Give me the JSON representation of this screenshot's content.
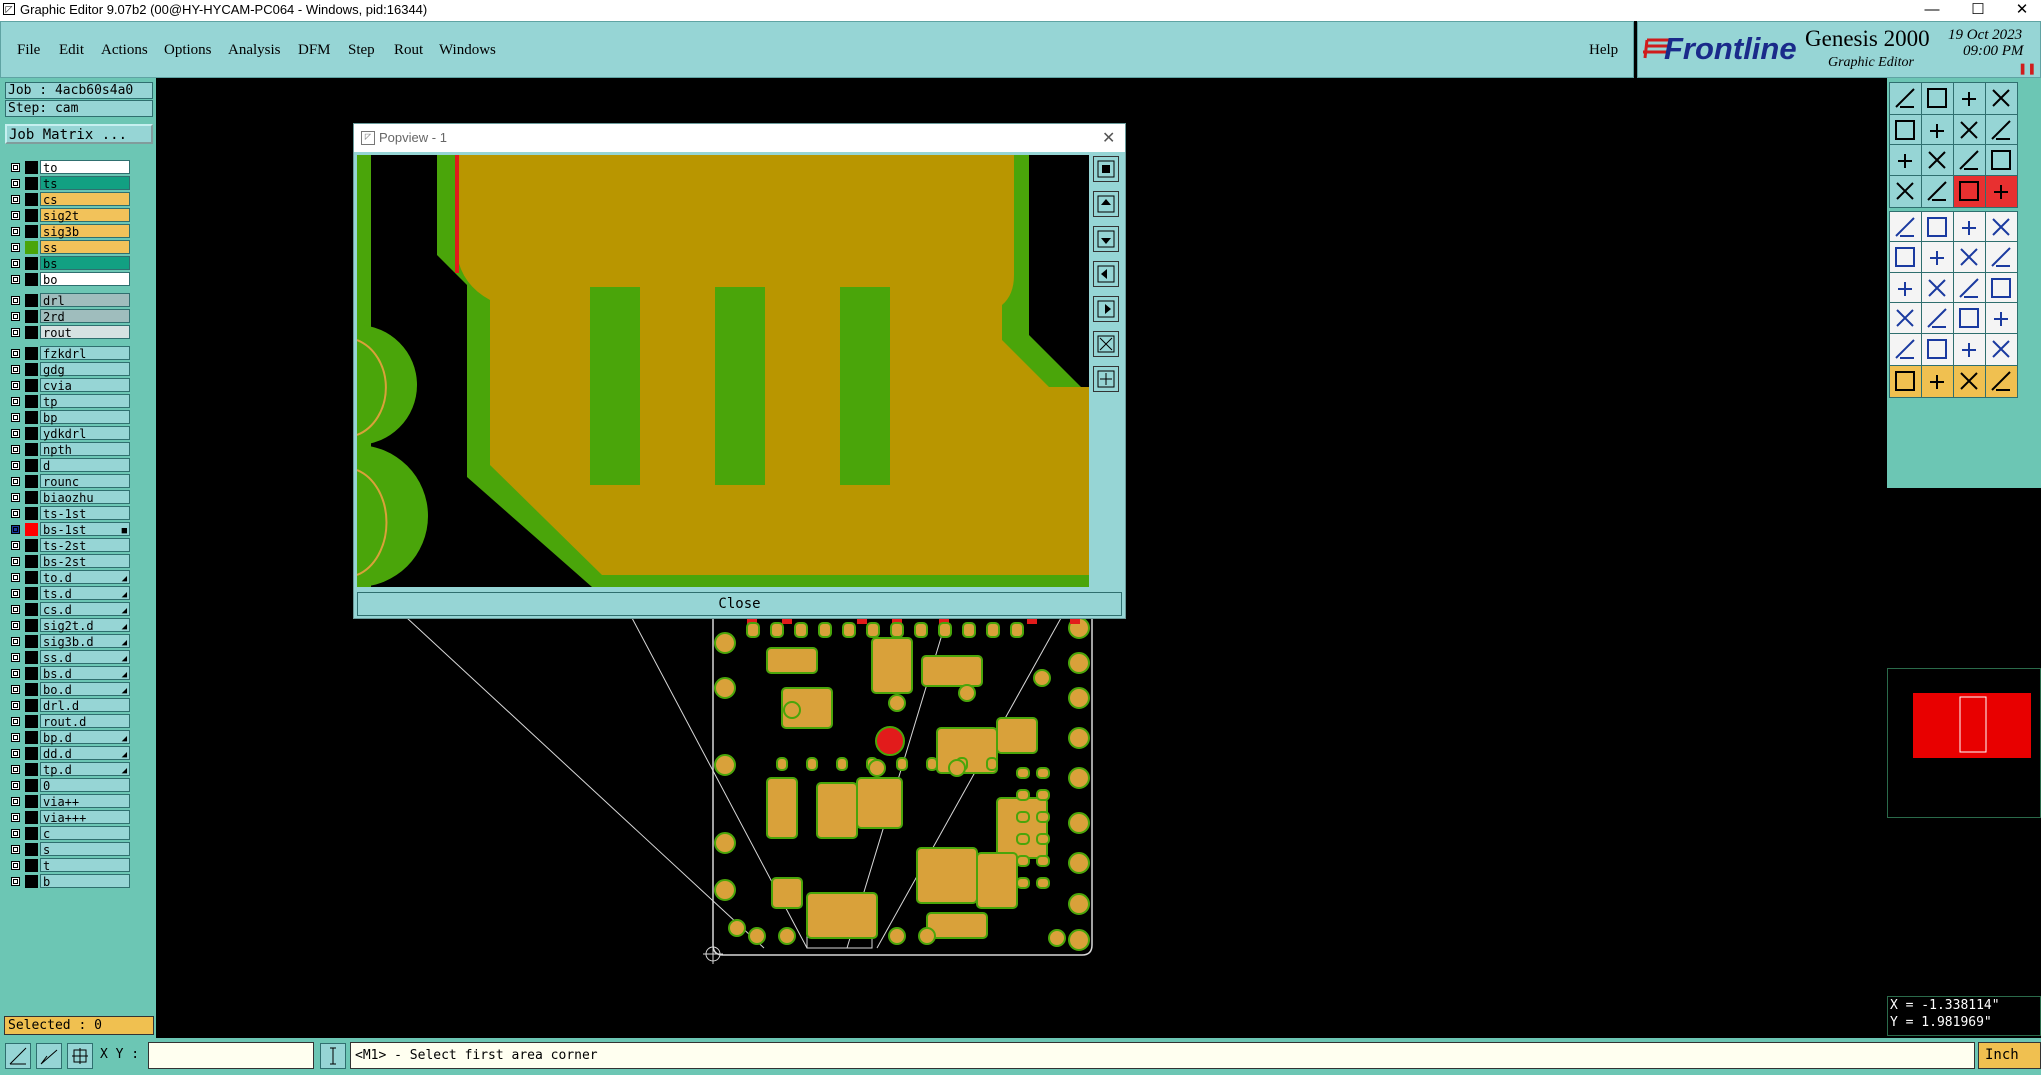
{
  "window": {
    "title": "Graphic Editor 9.07b2 (00@HY-HYCAM-PC064 - Windows, pid:16344)"
  },
  "menu": [
    "File",
    "Edit",
    "Actions",
    "Options",
    "Analysis",
    "DFM",
    "Step",
    "Rout",
    "Windows"
  ],
  "help_label": "Help",
  "branding": {
    "logo": "Frontline",
    "product": "Genesis 2000",
    "subtitle": "Graphic Editor",
    "date": "19 Oct 2023",
    "time": "09:00 PM"
  },
  "job": {
    "job_label": "Job : 4acb60s4a0",
    "step_label": "Step: cam",
    "matrix_button": "Job Matrix ..."
  },
  "layers": [
    {
      "name": "to",
      "color": "#ffffff",
      "swatch": "#000000"
    },
    {
      "name": "ts",
      "color": "#12a082",
      "swatch": "#000000"
    },
    {
      "name": "cs",
      "color": "#f2c25a",
      "swatch": "#000000"
    },
    {
      "name": "sig2t",
      "color": "#f2c25a",
      "swatch": "#000000"
    },
    {
      "name": "sig3b",
      "color": "#f2c25a",
      "swatch": "#000000"
    },
    {
      "name": "ss",
      "color": "#f2c25a",
      "swatch": "#4aa50a"
    },
    {
      "name": "bs",
      "color": "#12a082",
      "swatch": "#000000"
    },
    {
      "name": "bo",
      "color": "#ffffff",
      "swatch": "#000000"
    },
    {
      "name": "drl",
      "color": "#9fbdbd",
      "swatch": "#000000"
    },
    {
      "name": "2rd",
      "color": "#9fbdbd",
      "swatch": "#000000"
    },
    {
      "name": "rout",
      "color": "#d6e2e2",
      "swatch": "#000000"
    },
    {
      "name": "fzkdrl",
      "color": "#96d5d5",
      "swatch": "#000000"
    },
    {
      "name": "gdg",
      "color": "#96d5d5",
      "swatch": "#000000"
    },
    {
      "name": "cvia",
      "color": "#96d5d5",
      "swatch": "#000000"
    },
    {
      "name": "tp",
      "color": "#96d5d5",
      "swatch": "#000000"
    },
    {
      "name": "bp",
      "color": "#96d5d5",
      "swatch": "#000000"
    },
    {
      "name": "ydkdrl",
      "color": "#96d5d5",
      "swatch": "#000000"
    },
    {
      "name": "npth",
      "color": "#96d5d5",
      "swatch": "#000000"
    },
    {
      "name": "d",
      "color": "#96d5d5",
      "swatch": "#000000"
    },
    {
      "name": "rounc",
      "color": "#96d5d5",
      "swatch": "#000000"
    },
    {
      "name": "biaozhu",
      "color": "#96d5d5",
      "swatch": "#000000"
    },
    {
      "name": "ts-1st",
      "color": "#96d5d5",
      "swatch": "#000000"
    },
    {
      "name": "bs-1st",
      "color": "#96d5d5",
      "swatch": "#ff0000",
      "active": true,
      "mark": "■"
    },
    {
      "name": "ts-2st",
      "color": "#96d5d5",
      "swatch": "#000000"
    },
    {
      "name": "bs-2st",
      "color": "#96d5d5",
      "swatch": "#000000"
    },
    {
      "name": "to.d",
      "color": "#96d5d5",
      "swatch": "#000000",
      "mark": "◢"
    },
    {
      "name": "ts.d",
      "color": "#96d5d5",
      "swatch": "#000000",
      "mark": "◢"
    },
    {
      "name": "cs.d",
      "color": "#96d5d5",
      "swatch": "#000000",
      "mark": "◢"
    },
    {
      "name": "sig2t.d",
      "color": "#96d5d5",
      "swatch": "#000000",
      "mark": "◢"
    },
    {
      "name": "sig3b.d",
      "color": "#96d5d5",
      "swatch": "#000000",
      "mark": "◢"
    },
    {
      "name": "ss.d",
      "color": "#96d5d5",
      "swatch": "#000000",
      "mark": "◢"
    },
    {
      "name": "bs.d",
      "color": "#96d5d5",
      "swatch": "#000000",
      "mark": "◢"
    },
    {
      "name": "bo.d",
      "color": "#96d5d5",
      "swatch": "#000000",
      "mark": "◢"
    },
    {
      "name": "drl.d",
      "color": "#96d5d5",
      "swatch": "#000000"
    },
    {
      "name": "rout.d",
      "color": "#96d5d5",
      "swatch": "#000000"
    },
    {
      "name": "bp.d",
      "color": "#96d5d5",
      "swatch": "#000000",
      "mark": "◢"
    },
    {
      "name": "dd.d",
      "color": "#96d5d5",
      "swatch": "#000000",
      "mark": "◢"
    },
    {
      "name": "tp.d",
      "color": "#96d5d5",
      "swatch": "#000000",
      "mark": "◢"
    },
    {
      "name": "0",
      "color": "#96d5d5",
      "swatch": "#000000"
    },
    {
      "name": "via++",
      "color": "#96d5d5",
      "swatch": "#000000"
    },
    {
      "name": "via+++",
      "color": "#96d5d5",
      "swatch": "#000000"
    },
    {
      "name": "c",
      "color": "#96d5d5",
      "swatch": "#000000"
    },
    {
      "name": "s",
      "color": "#96d5d5",
      "swatch": "#000000"
    },
    {
      "name": "t",
      "color": "#96d5d5",
      "swatch": "#000000"
    },
    {
      "name": "b",
      "color": "#96d5d5",
      "swatch": "#000000"
    }
  ],
  "popview": {
    "title": "Popview - 1",
    "close_label": "Close"
  },
  "selected_label": "Selected : 0",
  "xy_label": "X Y :",
  "xy_input_value": "",
  "status_message": "<M1> - Select first area corner",
  "coords": {
    "x": "X = -1.338114\"",
    "y": "Y = 1.981969\""
  },
  "unit_label": "Inch",
  "colors": {
    "panel": "#96d5d5",
    "panel_dark": "#6cc6b4",
    "copper": "#b99600",
    "mask": "#4aa50a",
    "pad": "#d9a13a",
    "pad_red": "#e21b1b",
    "accent": "#f0c050"
  }
}
